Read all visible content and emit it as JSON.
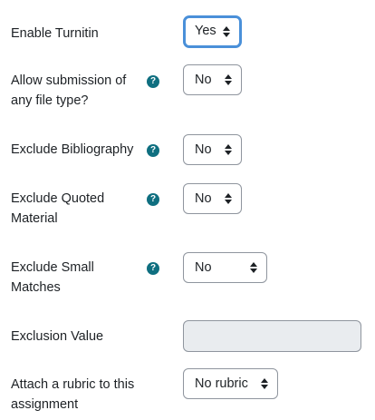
{
  "form": {
    "rows": [
      {
        "label": "Enable Turnitin",
        "value": "Yes",
        "help": false
      },
      {
        "label": "Allow submission of any file type?",
        "value": "No",
        "help": true
      },
      {
        "label": "Exclude Bibliography",
        "value": "No",
        "help": true
      },
      {
        "label": "Exclude Quoted Material",
        "value": "No",
        "help": true
      },
      {
        "label": "Exclude Small Matches",
        "value": "No",
        "help": true
      },
      {
        "label": "Exclusion Value",
        "value": "",
        "help": false
      },
      {
        "label": "Attach a rubric to this assignment",
        "value": "No rubric",
        "help": false
      }
    ],
    "help_glyph": "?",
    "help_icon": "question-circle-icon",
    "caret_icon": "sort-caret-icon",
    "colors": {
      "help_icon_bg": "#0f6f80",
      "focus_border": "#4a90d9",
      "disabled_bg": "#e9ecef"
    }
  }
}
